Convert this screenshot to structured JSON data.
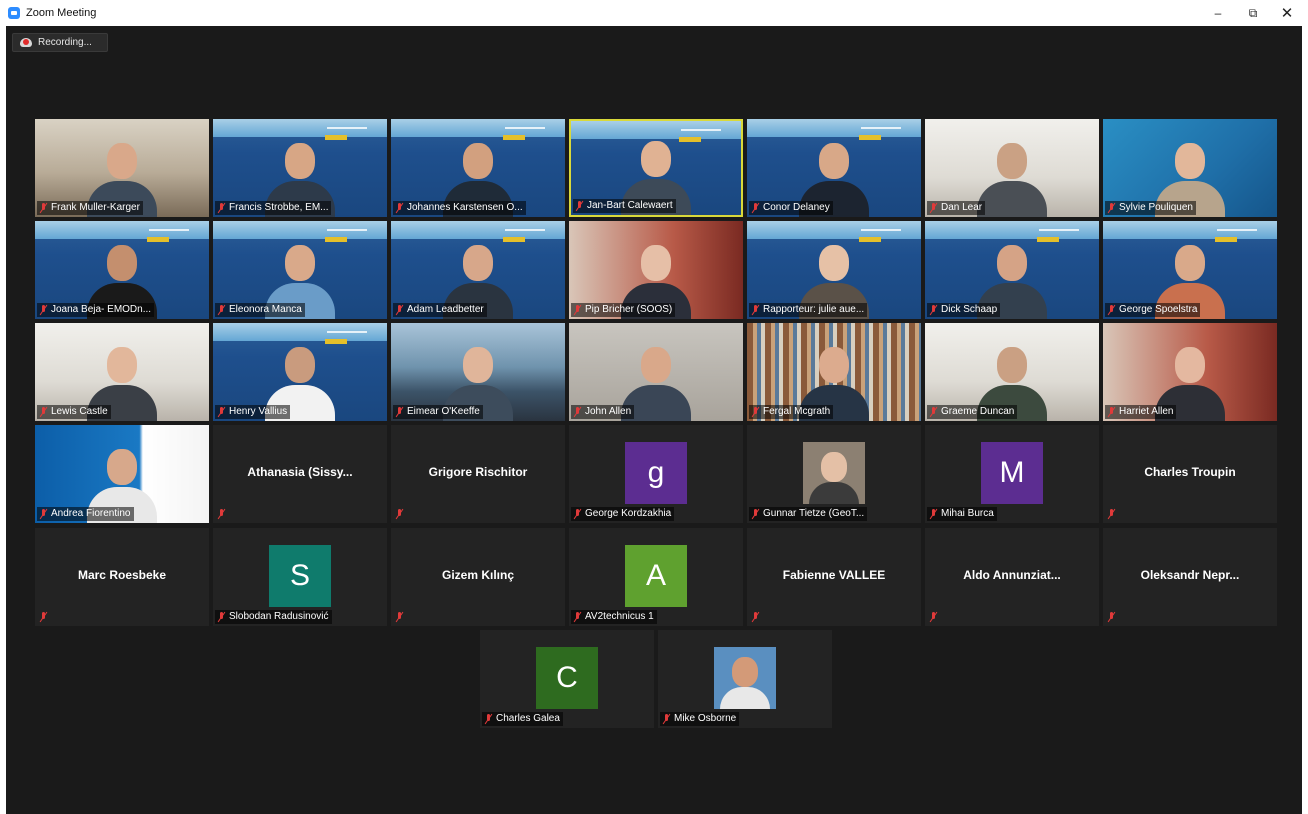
{
  "window": {
    "title": "Zoom Meeting",
    "minimize": "–",
    "maximize": "⧉",
    "close": "✕"
  },
  "recording": {
    "label": "Recording..."
  },
  "tiles": [
    {
      "name": "Frank Muller-Karger",
      "kind": "video",
      "bg": "room",
      "body": "#3c4a5a",
      "head": "#d9a88a"
    },
    {
      "name": "Francis Strobbe, EM...",
      "kind": "video",
      "bg": "banner",
      "body": "#2d3a4a",
      "head": "#d7a685"
    },
    {
      "name": "Johannes Karstensen O...",
      "kind": "video",
      "bg": "banner",
      "body": "#1f2b38",
      "head": "#d2a07f"
    },
    {
      "name": "Jan-Bart Calewaert",
      "kind": "video",
      "bg": "banner",
      "body": "#3d4a58",
      "head": "#e0b293",
      "active": true
    },
    {
      "name": "Conor Delaney",
      "kind": "video",
      "bg": "banner",
      "body": "#1c2430",
      "head": "#d8a888"
    },
    {
      "name": "Dan Lear",
      "kind": "video",
      "bg": "white",
      "body": "#4a4f55",
      "head": "#caa184"
    },
    {
      "name": "Sylvie Pouliquen",
      "kind": "video",
      "bg": "argo",
      "body": "#b7a48c",
      "head": "#e2b79a"
    },
    {
      "name": "Joana Beja- EMODn...",
      "kind": "video",
      "bg": "banner",
      "body": "#1a1a1a",
      "head": "#c48f6e"
    },
    {
      "name": "Eleonora Manca",
      "kind": "video",
      "bg": "banner",
      "body": "#6a9cc8",
      "head": "#d9a98a"
    },
    {
      "name": "Adam Leadbetter",
      "kind": "video",
      "bg": "banner",
      "body": "#2a3440",
      "head": "#d7a78a"
    },
    {
      "name": "Pip Bricher (SOOS)",
      "kind": "video",
      "bg": "red",
      "body": "#2b2f3a",
      "head": "#e6bfa7"
    },
    {
      "name": "Rapporteur: julie aue...",
      "kind": "video",
      "bg": "banner",
      "body": "#5a5148",
      "head": "#e6c1a6"
    },
    {
      "name": "Dick Schaap",
      "kind": "video",
      "bg": "banner",
      "body": "#33404e",
      "head": "#d5a386"
    },
    {
      "name": "George Spoelstra",
      "kind": "video",
      "bg": "banner",
      "body": "#c9704e",
      "head": "#d9a98a"
    },
    {
      "name": "Lewis Castle",
      "kind": "video",
      "bg": "white",
      "body": "#3a3f46",
      "head": "#e2b79b"
    },
    {
      "name": "Henry Vallius",
      "kind": "video",
      "bg": "banner",
      "body": "#f2f2f2",
      "head": "#c99b7e"
    },
    {
      "name": "Eimear O'Keeffe",
      "kind": "video",
      "bg": "sea",
      "body": "#3d4c5c",
      "head": "#e0b59a"
    },
    {
      "name": "John Allen",
      "kind": "video",
      "bg": "gray",
      "body": "#3a4656",
      "head": "#d9a88a"
    },
    {
      "name": "Fergal Mcgrath",
      "kind": "video",
      "bg": "books",
      "body": "#263445",
      "head": "#dcab8e"
    },
    {
      "name": "Graeme Duncan",
      "kind": "video",
      "bg": "white",
      "body": "#3c4a3e",
      "head": "#caa083"
    },
    {
      "name": "Harriet Allen",
      "kind": "video",
      "bg": "red",
      "body": "#2d2f36",
      "head": "#e4b8a0"
    },
    {
      "name": "Andrea Fiorentino",
      "kind": "video",
      "bg": "emod",
      "body": "#e8e8e8",
      "head": "#d7a88b"
    },
    {
      "name": "",
      "center": "Athanasia (Sissy...",
      "kind": "name"
    },
    {
      "name": "",
      "center": "Grigore Rischitor",
      "kind": "name"
    },
    {
      "name": "George Kordzakhia",
      "kind": "letter",
      "letter": "g",
      "color": "#5c2d91"
    },
    {
      "name": "Gunnar Tietze (GeoT...",
      "kind": "photo",
      "photo_bg": "#8c8072",
      "head": "#e4c0a6",
      "body": "#3b3b3b"
    },
    {
      "name": "Mihai Burca",
      "kind": "letter",
      "letter": "M",
      "color": "#5c2d91"
    },
    {
      "name": "",
      "center": "Charles Troupin",
      "kind": "name"
    },
    {
      "name": "",
      "center": "Marc Roesbeke",
      "kind": "name"
    },
    {
      "name": "Slobodan Radusinović",
      "kind": "letter",
      "letter": "S",
      "color": "#0f7b6c"
    },
    {
      "name": "",
      "center": "Gizem Kılınç",
      "kind": "name"
    },
    {
      "name": "AV2technicus 1",
      "kind": "letter",
      "letter": "A",
      "color": "#5fa12f"
    },
    {
      "name": "",
      "center": "Fabienne VALLEE",
      "kind": "name"
    },
    {
      "name": "",
      "center": "Aldo  Annunziat...",
      "kind": "name"
    },
    {
      "name": "",
      "center": "Oleksandr  Nepr...",
      "kind": "name"
    },
    {
      "name": "Charles Galea",
      "kind": "letter",
      "letter": "C",
      "color": "#2e6b1f"
    },
    {
      "name": "Mike Osborne",
      "kind": "photo",
      "photo_bg": "#5a8fc0",
      "head": "#d39a78",
      "body": "#e8e8e8"
    }
  ]
}
